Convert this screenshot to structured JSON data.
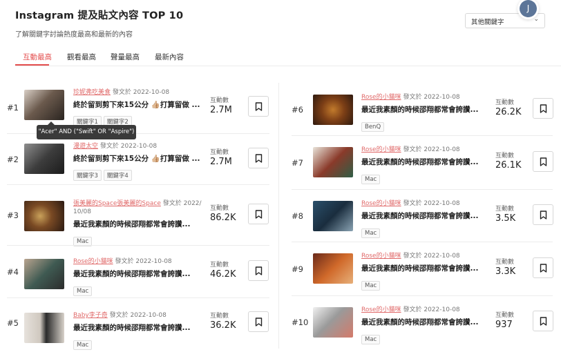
{
  "header": {
    "title": "Instagram 提及貼文內容 TOP 10",
    "subtitle": "了解關鍵字討論熱度最高和最新的內容"
  },
  "keyword_select": {
    "value": "其他關鍵字"
  },
  "avatar": {
    "initial": "J"
  },
  "tabs": [
    {
      "label": "互動最高",
      "active": true
    },
    {
      "label": "觀看最高",
      "active": false
    },
    {
      "label": "聲量最高",
      "active": false
    },
    {
      "label": "最新內容",
      "active": false
    }
  ],
  "tooltip": {
    "text": "\"Acer\" AND (\"Swift\" OR \"Aspire\")"
  },
  "metric_label": "互動數",
  "posted_suffix": "發文於",
  "posts_left": [
    {
      "rank": "#1",
      "author": "珍妮弗吃美食",
      "date": "2022-10-08",
      "title": "終於留到剪下來15公分 👍🏼打算留做 ...",
      "tags": [
        "關鍵字1",
        "關鍵字2"
      ],
      "value": "2.7M"
    },
    {
      "rank": "#2",
      "author": "漫遊太空",
      "date": "2022-10-08",
      "title": "終於留到剪下來15公分 👍🏼打算留做 ...",
      "tags": [
        "關鍵字3",
        "關鍵字4"
      ],
      "value": "2.7M"
    },
    {
      "rank": "#3",
      "author": "張美麗的Space張美麗的Space",
      "date_line1": "2022/",
      "date_line2": "10/08",
      "title": "最近我素顏的時候邵翔都常會誇讚...",
      "tags": [
        "Mac"
      ],
      "value": "86.2K"
    },
    {
      "rank": "#4",
      "author": "Rose的小貓咪",
      "date": "2022-10-08",
      "title": "最近我素顏的時候邵翔都常會誇讚...",
      "tags": [
        "Mac"
      ],
      "value": "46.2K"
    },
    {
      "rank": "#5",
      "author": "Baby李子奇",
      "date": "2022-10-08",
      "title": "最近我素顏的時候邵翔都常會誇讚...",
      "tags": [
        "Mac"
      ],
      "value": "36.2K"
    }
  ],
  "posts_right": [
    {
      "rank": "#6",
      "author": "Rose的小貓咪",
      "date": "2022-10-08",
      "title": "最近我素顏的時候邵翔都常會誇讚...",
      "tags": [
        "BenQ"
      ],
      "value": "26.2K"
    },
    {
      "rank": "#7",
      "author": "Rose的小貓咪",
      "date": "2022-10-08",
      "title": "最近我素顏的時候邵翔都常會誇讚...",
      "tags": [
        "Mac"
      ],
      "value": "26.1K"
    },
    {
      "rank": "#8",
      "author": "Rose的小貓咪",
      "date": "2022-10-08",
      "title": "最近我素顏的時候邵翔都常會誇讚...",
      "tags": [
        "Mac"
      ],
      "value": "3.5K"
    },
    {
      "rank": "#9",
      "author": "Rose的小貓咪",
      "date": "2022-10-08",
      "title": "最近我素顏的時候邵翔都常會誇讚...",
      "tags": [
        "Mac"
      ],
      "value": "3.3K"
    },
    {
      "rank": "#10",
      "author": "Rose的小貓咪",
      "date": "2022-10-08",
      "title": "最近我素顏的時候邵翔都常會誇讚...",
      "tags": [
        "Mac"
      ],
      "value": "937"
    }
  ]
}
